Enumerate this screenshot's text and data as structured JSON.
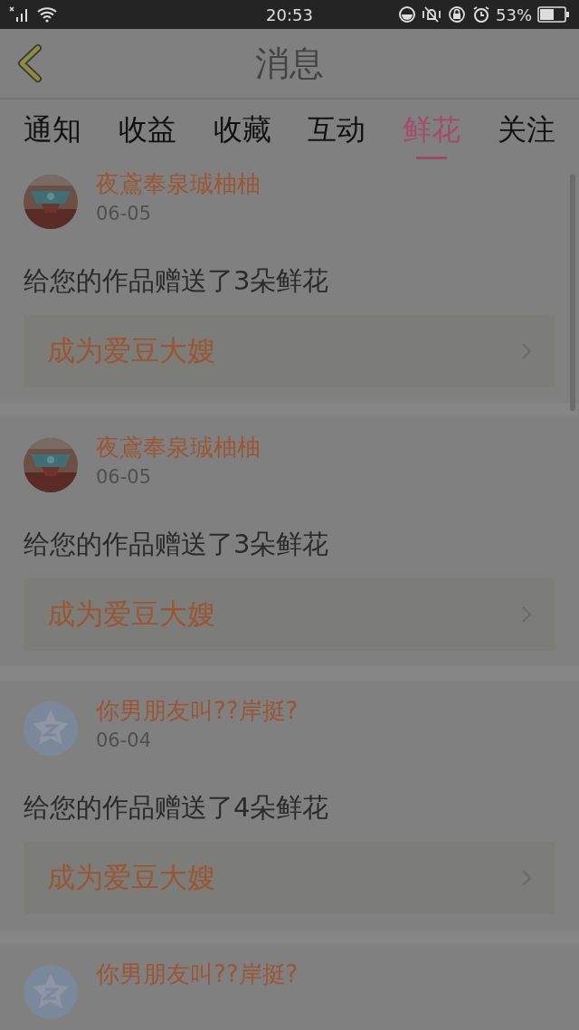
{
  "status_bar": {
    "time": "20:53",
    "battery": "53%"
  },
  "header": {
    "title": "消息"
  },
  "tabs": [
    {
      "label": "通知",
      "selected": false
    },
    {
      "label": "收益",
      "selected": false
    },
    {
      "label": "收藏",
      "selected": false
    },
    {
      "label": "互动",
      "selected": false
    },
    {
      "label": "鲜花",
      "selected": true
    },
    {
      "label": "关注",
      "selected": false
    }
  ],
  "messages": [
    {
      "name": "夜鳶奉泉珹柚柚",
      "date": "06-05",
      "text": "给您的作品赠送了3朵鲜花",
      "action": "成为爱豆大嫂"
    },
    {
      "name": "夜鳶奉泉珹柚柚",
      "date": "06-05",
      "text": "给您的作品赠送了3朵鲜花",
      "action": "成为爱豆大嫂"
    },
    {
      "kind": "default",
      "name": "你男朋友叫??岸挺?",
      "date": "06-04",
      "text": "给您的作品赠送了4朵鲜花",
      "action": "成为爱豆大嫂"
    },
    {
      "kind": "default",
      "name": "你男朋友叫??岸挺?"
    }
  ]
}
